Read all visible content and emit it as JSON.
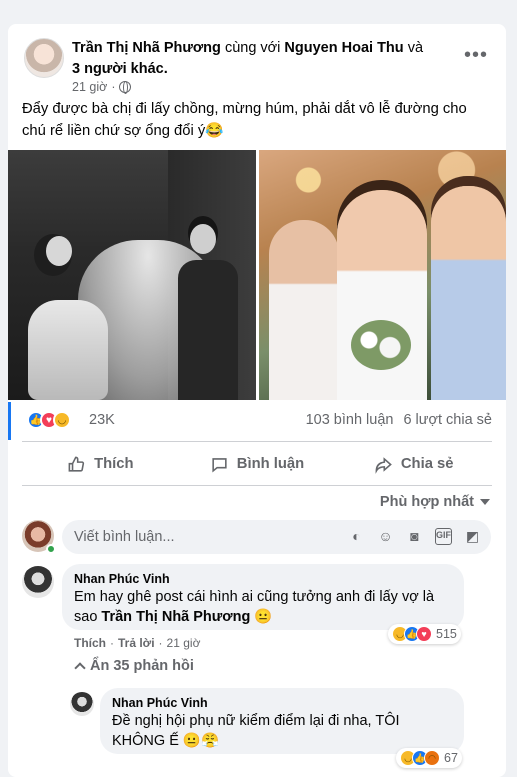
{
  "post": {
    "author": "Trần Thị Nhã Phương",
    "with_text": "cùng với",
    "tagged": "Nguyen Hoai Thu",
    "and_text": "và",
    "others": "3 người khác.",
    "time": "21 giờ",
    "more_glyph": "•••",
    "text": "Đẩy được bà chị đi lấy chồng, mừng húm, phải dắt vô lễ đường cho chú rể liền chứ sợ ổng đổi ý😂"
  },
  "reactions": {
    "count": "23K",
    "comments": "103 bình luận",
    "shares": "6 lượt chia sẻ",
    "icons": [
      "like",
      "love",
      "haha"
    ]
  },
  "actions": {
    "like": "Thích",
    "comment": "Bình luận",
    "share": "Chia sẻ"
  },
  "sort": {
    "label": "Phù hợp nhất"
  },
  "composer": {
    "placeholder": "Viết bình luận...",
    "icons": [
      "sticker-face-icon",
      "emoji-icon",
      "camera-icon",
      "gif-icon",
      "sticker-icon"
    ]
  },
  "comments": [
    {
      "name": "Nhan Phúc Vinh",
      "text": "Em hay ghê post cái hình ai cũng tưởng anh đi lấy vợ là sao",
      "mention": "Trần Thị Nhã Phương",
      "emoji": "😐",
      "like": "Thích",
      "reply": "Trả lời",
      "time": "21 giờ",
      "reaction_count": "515"
    }
  ],
  "hide_replies": "Ẩn 35 phản hồi",
  "replies": [
    {
      "name": "Nhan Phúc Vinh",
      "text": "Đề nghị hội phụ nữ kiểm điểm lại đi nha, TÔI KHÔNG Ế",
      "emoji": "😐😤",
      "reaction_count": "67"
    }
  ],
  "colors": {
    "accent": "#1877f2",
    "like": "#1877f2",
    "love": "#f33e58",
    "haha": "#f7b928",
    "online": "#31a24c"
  }
}
